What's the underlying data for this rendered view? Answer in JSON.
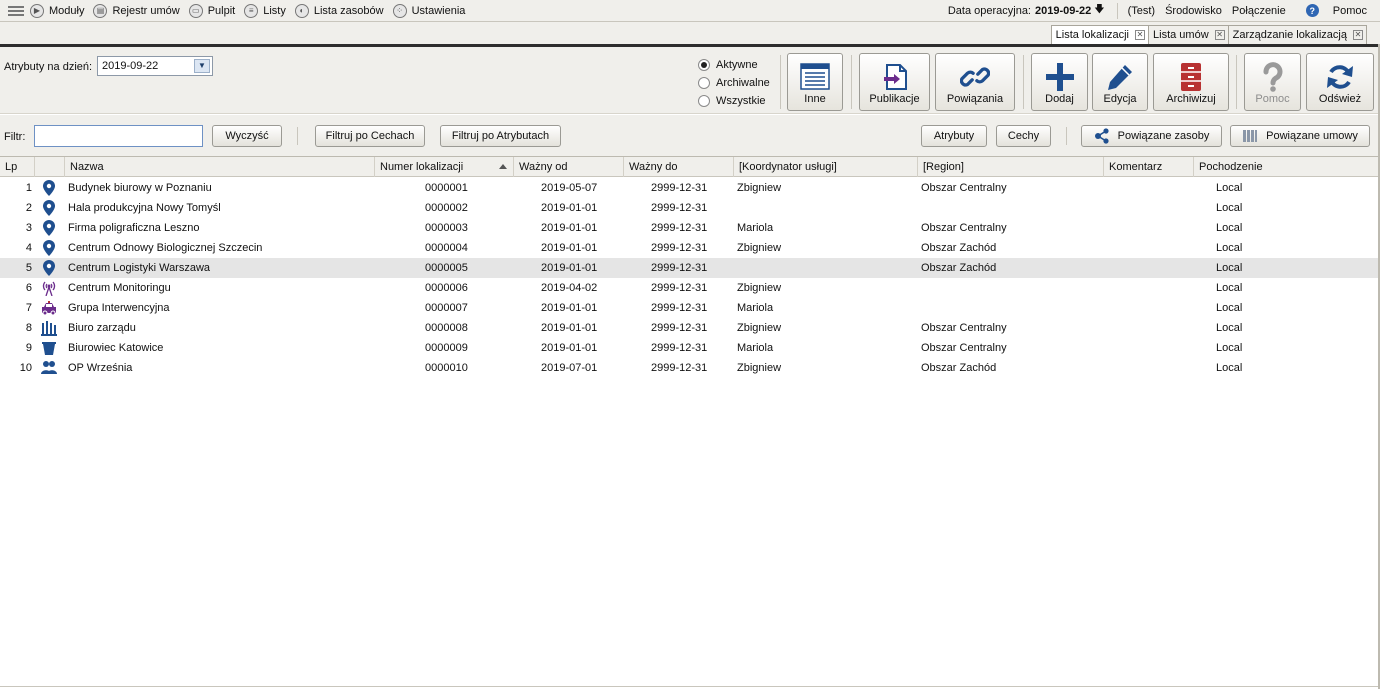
{
  "menu": {
    "items": [
      {
        "label": "Moduły",
        "icon": "play-circle-icon"
      },
      {
        "label": "Rejestr umów",
        "icon": "register-icon"
      },
      {
        "label": "Pulpit",
        "icon": "desktop-icon"
      },
      {
        "label": "Listy",
        "icon": "list-icon"
      },
      {
        "label": "Lista zasobów",
        "icon": "resources-icon"
      },
      {
        "label": "Ustawienia",
        "icon": "settings-icon"
      }
    ],
    "opdate_label": "Data operacyjna:",
    "opdate_value": "2019-09-22",
    "env_test": "(Test)",
    "env": "Środowisko",
    "connection": "Połączenie",
    "help": "Pomoc"
  },
  "tabs": [
    {
      "label": "Lista lokalizacji",
      "active": true
    },
    {
      "label": "Lista umów",
      "active": false
    },
    {
      "label": "Zarządzanie lokalizacją",
      "active": false
    }
  ],
  "toolbar": {
    "attr_label": "Atrybuty na dzień:",
    "attr_date": "2019-09-22",
    "radios": [
      {
        "label": "Aktywne",
        "checked": true
      },
      {
        "label": "Archiwalne",
        "checked": false
      },
      {
        "label": "Wszystkie",
        "checked": false
      }
    ],
    "buttons": {
      "inne": "Inne",
      "publikacje": "Publikacje",
      "powiazania": "Powiązania",
      "dodaj": "Dodaj",
      "edycja": "Edycja",
      "archiwizuj": "Archiwizuj",
      "pomoc": "Pomoc",
      "odswiez": "Odśwież"
    }
  },
  "filter": {
    "label": "Filtr:",
    "value": "",
    "clear": "Wyczyść",
    "by_features": "Filtruj po Cechach",
    "by_attributes": "Filtruj po Atrybutach",
    "attributes": "Atrybuty",
    "features": "Cechy",
    "related_resources": "Powiązane zasoby",
    "related_contracts": "Powiązane umowy"
  },
  "table": {
    "columns": {
      "lp": "Lp",
      "name": "Nazwa",
      "number": "Numer lokalizacji",
      "valid_from": "Ważny od",
      "valid_to": "Ważny do",
      "coordinator": "[Koordynator usługi]",
      "region": "[Region]",
      "comment": "Komentarz",
      "origin": "Pochodzenie"
    },
    "rows": [
      {
        "lp": "1",
        "icon": "location-pin-icon",
        "name": "Budynek biurowy w Poznaniu",
        "number": "0000001",
        "valid_from": "2019-05-07",
        "valid_to": "2999-12-31",
        "coordinator": "Zbigniew",
        "region": "Obszar Centralny",
        "comment": "",
        "origin": "Local",
        "selected": false
      },
      {
        "lp": "2",
        "icon": "location-pin-icon",
        "name": "Hala produkcyjna Nowy Tomyśl",
        "number": "0000002",
        "valid_from": "2019-01-01",
        "valid_to": "2999-12-31",
        "coordinator": "",
        "region": "",
        "comment": "",
        "origin": "Local",
        "selected": false
      },
      {
        "lp": "3",
        "icon": "location-pin-icon",
        "name": "Firma poligraficzna Leszno",
        "number": "0000003",
        "valid_from": "2019-01-01",
        "valid_to": "2999-12-31",
        "coordinator": "Mariola",
        "region": "Obszar Centralny",
        "comment": "",
        "origin": "Local",
        "selected": false
      },
      {
        "lp": "4",
        "icon": "location-pin-icon",
        "name": "Centrum Odnowy Biologicznej Szczecin",
        "number": "0000004",
        "valid_from": "2019-01-01",
        "valid_to": "2999-12-31",
        "coordinator": "Zbigniew",
        "region": "Obszar Zachód",
        "comment": "",
        "origin": "Local",
        "selected": false
      },
      {
        "lp": "5",
        "icon": "location-pin-icon",
        "name": "Centrum Logistyki Warszawa",
        "number": "0000005",
        "valid_from": "2019-01-01",
        "valid_to": "2999-12-31",
        "coordinator": "",
        "region": "Obszar Zachód",
        "comment": "",
        "origin": "Local",
        "selected": true
      },
      {
        "lp": "6",
        "icon": "antenna-icon",
        "name": "Centrum Monitoringu",
        "number": "0000006",
        "valid_from": "2019-04-02",
        "valid_to": "2999-12-31",
        "coordinator": "Zbigniew",
        "region": "",
        "comment": "",
        "origin": "Local",
        "selected": false
      },
      {
        "lp": "7",
        "icon": "car-icon",
        "name": "Grupa Interwencyjna",
        "number": "0000007",
        "valid_from": "2019-01-01",
        "valid_to": "2999-12-31",
        "coordinator": "Mariola",
        "region": "",
        "comment": "",
        "origin": "Local",
        "selected": false
      },
      {
        "lp": "8",
        "icon": "office-building-icon",
        "name": "Biuro zarządu",
        "number": "0000008",
        "valid_from": "2019-01-01",
        "valid_to": "2999-12-31",
        "coordinator": "Zbigniew",
        "region": "Obszar Centralny",
        "comment": "",
        "origin": "Local",
        "selected": false
      },
      {
        "lp": "9",
        "icon": "bucket-icon",
        "name": "Biurowiec Katowice",
        "number": "0000009",
        "valid_from": "2019-01-01",
        "valid_to": "2999-12-31",
        "coordinator": "Mariola",
        "region": "Obszar Centralny",
        "comment": "",
        "origin": "Local",
        "selected": false
      },
      {
        "lp": "10",
        "icon": "people-icon",
        "name": "OP Września",
        "number": "0000010",
        "valid_from": "2019-07-01",
        "valid_to": "2999-12-31",
        "coordinator": "Zbigniew",
        "region": "Obszar Zachód",
        "comment": "",
        "origin": "Local",
        "selected": false
      }
    ]
  },
  "colors": {
    "accent_blue": "#1f4f8f",
    "purple": "#6b2c8c",
    "archive_red": "#b83232",
    "selected_row": "#e5e5e5"
  }
}
